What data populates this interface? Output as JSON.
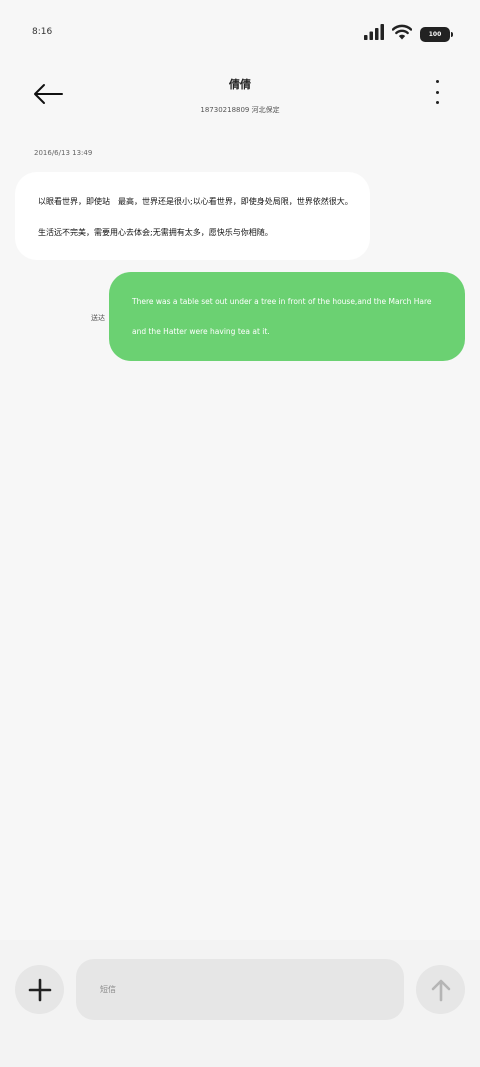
{
  "status_bar": {
    "time": "8:16",
    "battery_level": "100",
    "icons": [
      "signal-icon",
      "wifi-icon",
      "battery-icon"
    ]
  },
  "header": {
    "contact_name": "倩倩",
    "contact_detail": "18730218809 河北保定",
    "icons": [
      "back-arrow-icon",
      "more-vertical-icon"
    ]
  },
  "conversation": {
    "timestamp": "2016/6/13 13:49",
    "incoming": {
      "lines": [
        "以眼看世界，即使站　最高，世界还是很小;以心看世界，即使身处局限，世界依然很大。",
        "生活远不完美，需要用心去体会;无需拥有太多，愿快乐与你相随。"
      ]
    },
    "outgoing": {
      "status": "送达",
      "lines": [
        "There was a table set out under a tree in front of the house,and the March Hare",
        "and the Hatter were having tea at it."
      ]
    }
  },
  "composer": {
    "placeholder": "短信",
    "icons": [
      "plus-icon",
      "send-arrow-icon"
    ]
  },
  "colors": {
    "background": "#f7f7f7",
    "incoming_bubble": "#ffffff",
    "outgoing_bubble": "#6bd172",
    "input_background": "#e6e6e6"
  }
}
